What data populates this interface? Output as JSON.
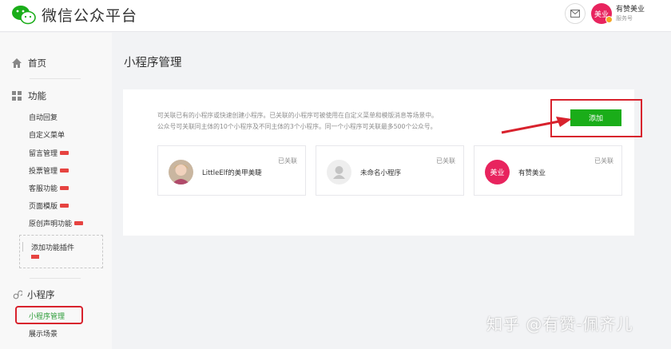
{
  "header": {
    "brand": "微信公众平台",
    "account_avatar_text": "美业",
    "account_name": "有赞美业",
    "account_type": "服务号"
  },
  "sidebar": {
    "home": "首页",
    "features_head": "功能",
    "features": [
      {
        "label": "自动回复",
        "new": false
      },
      {
        "label": "自定义菜单",
        "new": false
      },
      {
        "label": "留言管理",
        "new": true
      },
      {
        "label": "投票管理",
        "new": true
      },
      {
        "label": "客服功能",
        "new": true
      },
      {
        "label": "页面模版",
        "new": true
      },
      {
        "label": "原创声明功能",
        "new": true
      }
    ],
    "add_plugin": "添加功能插件",
    "miniprogram_head": "小程序",
    "miniprogram_manage": "小程序管理",
    "showcase": "展示场景"
  },
  "main": {
    "title": "小程序管理",
    "desc_line1": "可关联已有的小程序或快速创建小程序。已关联的小程序可被使用在自定义菜单和模版消息等场景中。",
    "desc_line2": "公众号可关联同主体的10个小程序及不同主体的3个小程序。同一个小程序可关联最多500个公众号。",
    "add_button": "添加",
    "cards": [
      {
        "name": "LittleElf的美甲美睫",
        "status": "已关联",
        "avatar": "photo"
      },
      {
        "name": "未命名小程序",
        "status": "已关联",
        "avatar": "placeholder"
      },
      {
        "name": "有赞美业",
        "status": "已关联",
        "avatar": "brand",
        "avatar_text": "美业"
      }
    ]
  },
  "watermark": "知乎 @有赞-佩齐儿",
  "colors": {
    "primary_green": "#1aad19",
    "highlight_red": "#d8222d",
    "brand_pink": "#e8245e"
  }
}
